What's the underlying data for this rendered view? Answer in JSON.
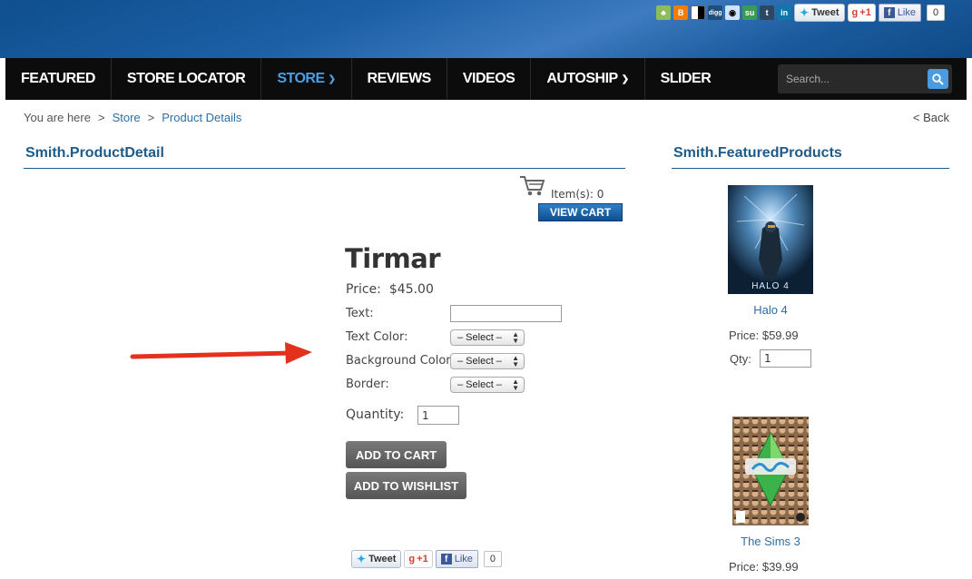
{
  "social": {
    "tweet_label": "Tweet",
    "gplus_label": "+1",
    "like_label": "Like",
    "like_count": "0",
    "icons": [
      "share-icon",
      "blogger-icon",
      "delicious-icon",
      "digg-icon",
      "reddit-icon",
      "stumbleupon-icon",
      "tumblr-icon",
      "linkedin-icon"
    ],
    "digg_text": "digg"
  },
  "nav": {
    "items": [
      {
        "label": "FEATURED"
      },
      {
        "label": "STORE LOCATOR"
      },
      {
        "label": "STORE"
      },
      {
        "label": "REVIEWS"
      },
      {
        "label": "VIDEOS"
      },
      {
        "label": "AUTOSHIP"
      },
      {
        "label": "SLIDER"
      }
    ],
    "active": "STORE",
    "search_placeholder": "Search..."
  },
  "breadcrumb": {
    "prefix": "You are here",
    "sep": ">",
    "store": "Store",
    "current": "Product Details",
    "back": "< Back"
  },
  "main": {
    "section_title": "Smith.ProductDetail",
    "cart_items": "Item(s): 0",
    "view_cart": "VIEW CART",
    "product": {
      "name": "Tirmar",
      "price_label": "Price:",
      "price": "$45.00",
      "text_label": "Text:",
      "text_color_label": "Text Color:",
      "bg_color_label": "Background Color:",
      "border_label": "Border:",
      "select_placeholder": "– Select –",
      "quantity_label": "Quantity:",
      "quantity_value": "1",
      "add_to_cart": "ADD TO CART",
      "add_to_wishlist": "ADD TO WISHLIST"
    },
    "bottom_social": {
      "tweet_label": "Tweet",
      "gplus_label": "+1",
      "like_label": "Like",
      "like_count": "0"
    }
  },
  "featured": {
    "section_title": "Smith.FeaturedProducts",
    "products": [
      {
        "name": "Halo 4",
        "price": "Price: $59.99",
        "qty_label": "Qty:",
        "qty": "1",
        "cover_text": "HALO 4"
      },
      {
        "name": "The Sims 3",
        "price": "Price: $39.99"
      }
    ]
  },
  "colors": {
    "nav_bg": "#0c0c0c",
    "active_nav": "#4aa0e6",
    "heading": "#1d5b8a",
    "link": "#2c6ea6",
    "button_gray": "#666666",
    "view_cart_blue": "#1a63a8",
    "arrow_red": "#e3311e"
  }
}
